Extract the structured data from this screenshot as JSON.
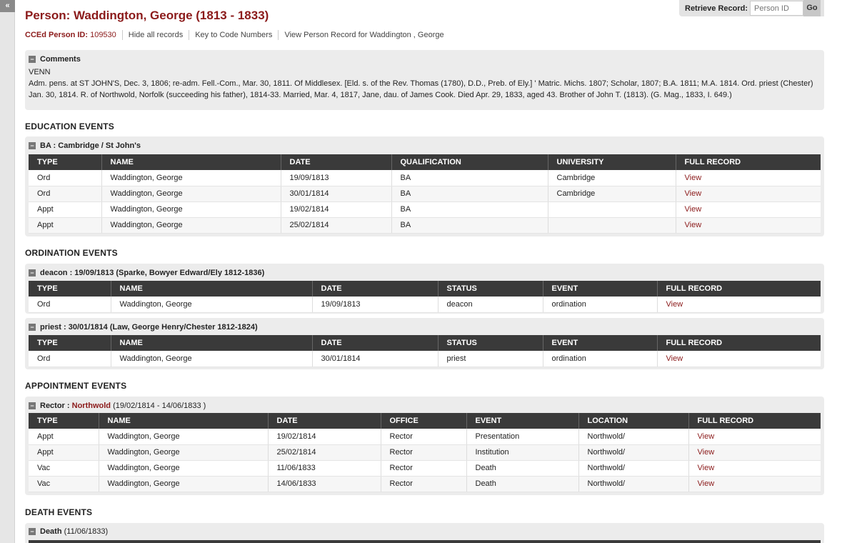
{
  "sidebar": {
    "collapse_label": "«"
  },
  "retrieve": {
    "label": "Retrieve Record:",
    "placeholder": "Person ID",
    "go_label": "Go"
  },
  "title": "Person: Waddington, George (1813 - 1833)",
  "subnav": {
    "person_id_label": "CCEd Person ID:",
    "person_id": "109530",
    "hide_all": "Hide all records",
    "key_codes": "Key to Code Numbers",
    "view_person": "View Person Record for Waddington , George"
  },
  "comments": {
    "title": "Comments",
    "source": "VENN",
    "text": "Adm. pens. at ST JOHN'S, Dec. 3, 1806; re-adm. Fell.-Com., Mar. 30, 1811. Of Middlesex. [Eld. s. of the Rev. Thomas (1780), D.D., Preb. of Ely.] ' Matric. Michs. 1807; Scholar, 1807; B.A. 1811; M.A. 1814. Ord. priest (Chester) Jan. 30, 1814. R. of Northwold, Norfolk (succeeding his father), 1814-33. Married, Mar. 4, 1817, Jane, dau. of James Cook. Died Apr. 29, 1833, aged 43. Brother of John T. (1813). (G. Mag., 1833, I. 649.)"
  },
  "education": {
    "heading": "EDUCATION EVENTS",
    "group_title": "BA : Cambridge / St John's",
    "columns": [
      "TYPE",
      "NAME",
      "DATE",
      "QUALIFICATION",
      "UNIVERSITY",
      "FULL RECORD"
    ],
    "rows": [
      {
        "type": "Ord",
        "name": "Waddington, George",
        "date": "19/09/1813",
        "qualification": "BA",
        "university": "Cambridge",
        "link": "View"
      },
      {
        "type": "Ord",
        "name": "Waddington, George",
        "date": "30/01/1814",
        "qualification": "BA",
        "university": "Cambridge",
        "link": "View"
      },
      {
        "type": "Appt",
        "name": "Waddington, George",
        "date": "19/02/1814",
        "qualification": "BA",
        "university": "",
        "link": "View"
      },
      {
        "type": "Appt",
        "name": "Waddington, George",
        "date": "25/02/1814",
        "qualification": "BA",
        "university": "",
        "link": "View"
      }
    ]
  },
  "ordination": {
    "heading": "ORDINATION EVENTS",
    "columns": [
      "TYPE",
      "NAME",
      "DATE",
      "STATUS",
      "EVENT",
      "FULL RECORD"
    ],
    "groups": [
      {
        "title": "deacon : 19/09/1813 (Sparke, Bowyer Edward/Ely 1812-1836)",
        "rows": [
          {
            "type": "Ord",
            "name": "Waddington, George",
            "date": "19/09/1813",
            "status": "deacon",
            "event": "ordination",
            "link": "View"
          }
        ]
      },
      {
        "title": "priest : 30/01/1814 (Law, George Henry/Chester 1812-1824)",
        "rows": [
          {
            "type": "Ord",
            "name": "Waddington, George",
            "date": "30/01/1814",
            "status": "priest",
            "event": "ordination",
            "link": "View"
          }
        ]
      }
    ]
  },
  "appointment": {
    "heading": "APPOINTMENT EVENTS",
    "group_office": "Rector :",
    "group_place": "Northwold",
    "group_dates": "(19/02/1814 - 14/06/1833 )",
    "columns": [
      "TYPE",
      "NAME",
      "DATE",
      "OFFICE",
      "EVENT",
      "LOCATION",
      "FULL RECORD"
    ],
    "rows": [
      {
        "type": "Appt",
        "name": "Waddington, George",
        "date": "19/02/1814",
        "office": "Rector",
        "event": "Presentation",
        "location": "Northwold/",
        "link": "View"
      },
      {
        "type": "Appt",
        "name": "Waddington, George",
        "date": "25/02/1814",
        "office": "Rector",
        "event": "Institution",
        "location": "Northwold/",
        "link": "View"
      },
      {
        "type": "Vac",
        "name": "Waddington, George",
        "date": "11/06/1833",
        "office": "Rector",
        "event": "Death",
        "location": "Northwold/",
        "link": "View"
      },
      {
        "type": "Vac",
        "name": "Waddington, George",
        "date": "14/06/1833",
        "office": "Rector",
        "event": "Death",
        "location": "Northwold/",
        "link": "View"
      }
    ]
  },
  "death": {
    "heading": "DEATH EVENTS",
    "group_label": "Death",
    "group_date": "(11/06/1833)"
  }
}
